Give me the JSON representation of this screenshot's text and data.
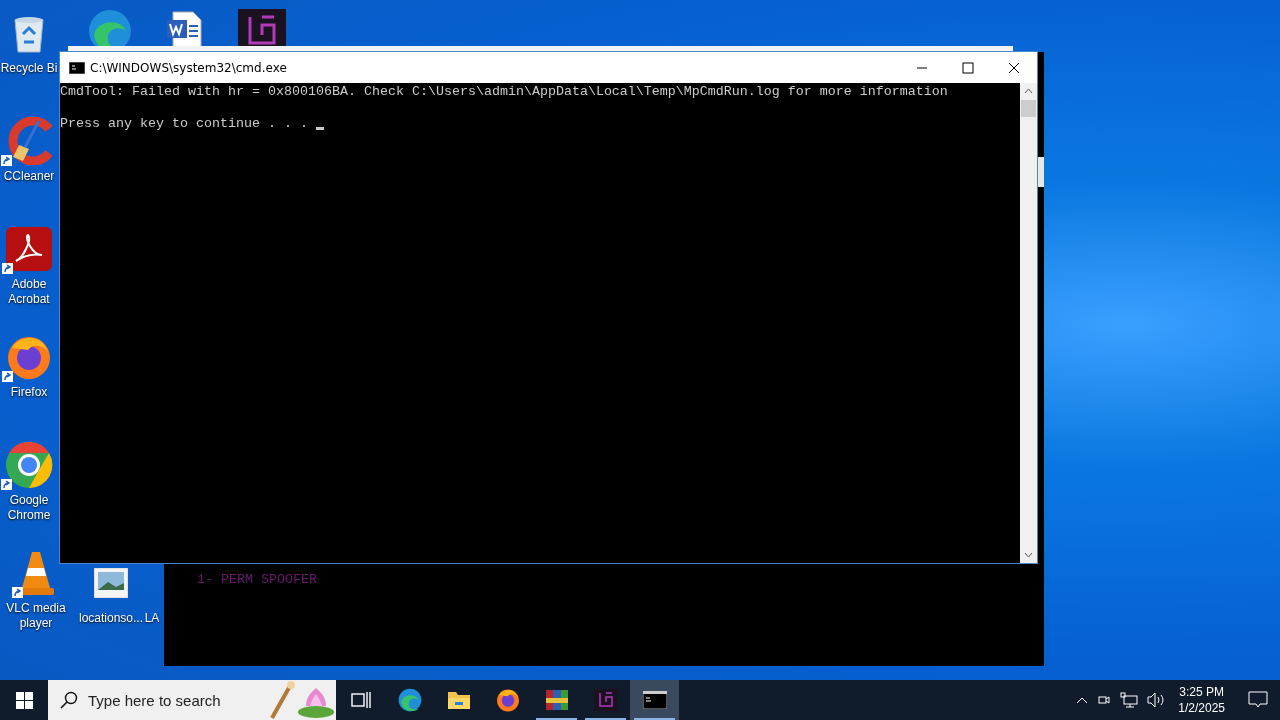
{
  "desktop_icons": [
    {
      "kind": "recycle",
      "label": "Recycle Bi"
    },
    {
      "kind": "edge"
    },
    {
      "kind": "word"
    },
    {
      "kind": "app"
    },
    {
      "kind": "ccleaner",
      "label": "CCleaner",
      "shortcut": true
    },
    {
      "kind": "acrobat",
      "label": "Adobe Acrobat",
      "shortcut": true
    },
    {
      "kind": "firefox",
      "label": "Firefox",
      "shortcut": true
    },
    {
      "kind": "chrome",
      "label": "Google Chrome",
      "shortcut": true
    },
    {
      "kind": "vlc",
      "label": "VLC media player",
      "shortcut": true
    },
    {
      "kind": "image",
      "label": "locationso..."
    },
    {
      "kind": "hidden",
      "label": "LA"
    }
  ],
  "back_window": {
    "console_lines": [
      "1- PERM SPOOFER"
    ]
  },
  "window": {
    "title": "C:\\WINDOWS\\system32\\cmd.exe",
    "console_lines": [
      "CmdTool: Failed with hr = 0x800106BA. Check C:\\Users\\admin\\AppData\\Local\\Temp\\MpCmdRun.log for more information",
      "Press any key to continue . . ."
    ]
  },
  "taskbar": {
    "search": {
      "placeholder": "Type here to search"
    },
    "apps": [
      {
        "kind": "taskview",
        "running": false,
        "selected": false
      },
      {
        "kind": "edge",
        "running": false,
        "selected": false
      },
      {
        "kind": "explorer",
        "running": false,
        "selected": false
      },
      {
        "kind": "firefox",
        "running": false,
        "selected": false
      },
      {
        "kind": "winrar",
        "running": true,
        "selected": false
      },
      {
        "kind": "app",
        "running": true,
        "selected": false
      },
      {
        "kind": "cmd",
        "running": true,
        "selected": true
      }
    ],
    "clock": {
      "time": "3:25 PM",
      "date": "1/2/2025"
    }
  }
}
